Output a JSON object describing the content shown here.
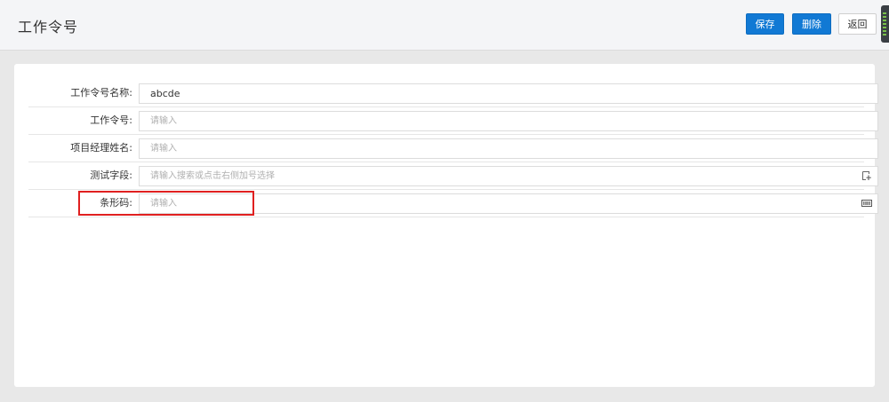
{
  "header": {
    "title": "工作令号",
    "save_label": "保存",
    "delete_label": "删除",
    "back_label": "返回"
  },
  "form": {
    "fields": [
      {
        "label": "工作令号名称:",
        "value": "abcde",
        "placeholder": ""
      },
      {
        "label": "工作令号:",
        "value": "",
        "placeholder": "请输入"
      },
      {
        "label": "项目经理姓名:",
        "value": "",
        "placeholder": "请输入"
      },
      {
        "label": "测试字段:",
        "value": "",
        "placeholder": "请输入搜索或点击右侧加号选择",
        "icon": "add-select-icon"
      },
      {
        "label": "条形码:",
        "value": "",
        "placeholder": "请输入",
        "icon": "barcode-icon"
      }
    ]
  },
  "colors": {
    "primary": "#1179d4",
    "highlight": "#e02020"
  }
}
